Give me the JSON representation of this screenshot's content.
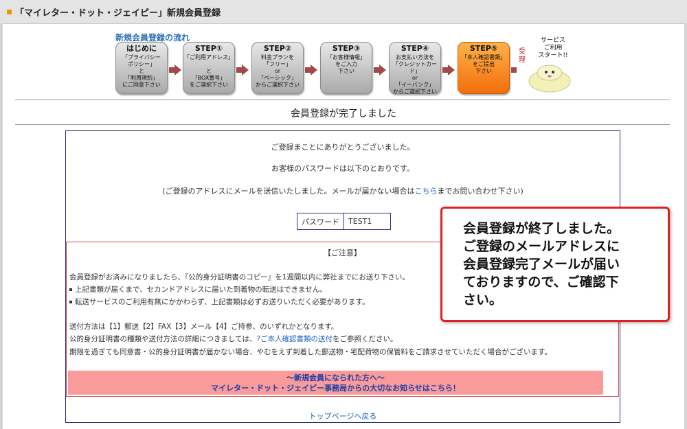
{
  "header": {
    "title": "「マイレター・ドット・ジェイピー」新規会員登録"
  },
  "flow": {
    "title": "新規会員登録の流れ",
    "steps": [
      {
        "heading": "はじめに",
        "desc": "「プライバシー\nポリシー」\nと\n「利用規約」\nにご同意下さい"
      },
      {
        "heading": "STEP①",
        "desc": "「ご利用アドレス」\n\nと\n「BOX番号」\nをご選択下さい"
      },
      {
        "heading": "STEP②",
        "desc": "料金プランを\n「フリー」\nor\n「ベーシック」\nからご選択下さい"
      },
      {
        "heading": "STEP③",
        "desc": "「お客様情報」\nをご入力\n下さい"
      },
      {
        "heading": "STEP④",
        "desc": "お支払い方法を\n「クレジットカード」\nor\n「イーバンク」\nからご選択下さい"
      },
      {
        "heading": "STEP⑤",
        "desc": "「本人確認書類」\nをご提出\n下さい"
      }
    ],
    "receipt": "受理",
    "service": "サービス\nご利用\nスタート!!"
  },
  "main": {
    "complete_title": "会員登録が完了しました",
    "thanks": "ご登録まことにありがとうございました。",
    "password_intro": "お客様のパスワードは以下のとおりです。",
    "mail_note_before": "(ご登録のアドレスにメールを送信いたしました。メールが届かない場合は",
    "mail_note_link": "こちら",
    "mail_note_after": "までお問い合わせ下さい)",
    "password_label": "パスワード",
    "password_value": "TEST1"
  },
  "notice": {
    "title": "【ご注意】",
    "line1": "会員登録がお済みになりましたら、『公的身分証明書のコピー』を1週間以内に弊社までにお送り下さい。",
    "bullet1": "上記書類が届くまで、セカンドアドレスに届いた到着物の転送はできません。",
    "bullet2": "転送サービスのご利用有無にかかわらず、上記書類は必ずお送りいただく必要があります。",
    "line2": "送付方法は【1】郵送【2】FAX【3】メール【4】ご持参、のいずれかとなります。",
    "line3_before": "公的身分証明書の種類や送付方法の詳細につきましては、",
    "line3_link": "?ご本人確認書類の送付",
    "line3_after": "をご参照ください。",
    "line4": "期限を過ぎても同意書・公的身分証明書が届かない場合、やむをえず到着した郵送物・宅配荷物の保管料をご請求させていただく場合がございます。",
    "banner_line1": "～新規会員になられた方へ～",
    "banner_line2": "マイレター・ドット・ジェイピー事務局からの大切なお知らせはこちら！"
  },
  "top_link": "トップページへ戻る",
  "callout": "会員登録が終了しました。\nご登録のメールアドレスに\n会員登録完了メールが届い\nておりますので、ご確認下\nさい。"
}
